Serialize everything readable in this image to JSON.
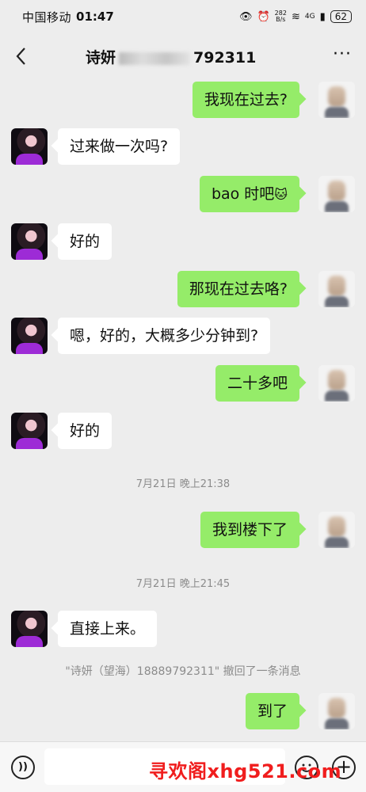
{
  "status": {
    "carrier": "中国移动",
    "time": "01:47",
    "net_speed_value": "282",
    "net_speed_unit": "B/s",
    "network": "4G",
    "battery": "62"
  },
  "header": {
    "title_start": "诗妍",
    "title_end": "792311",
    "back_icon": "chevron-left-icon",
    "more_icon": "more-dots-icon",
    "more_glyph": "···"
  },
  "messages": [
    {
      "from": "me",
      "text": "我现在过去?"
    },
    {
      "from": "them",
      "text": "过来做一次吗?"
    },
    {
      "from": "me",
      "text": "bao 时吧",
      "emoji": "🐱"
    },
    {
      "from": "them",
      "text": "好的"
    },
    {
      "from": "me",
      "text": "那现在过去咯?"
    },
    {
      "from": "them",
      "text": "嗯，好的，大概多少分钟到?"
    },
    {
      "from": "me",
      "text": "二十多吧"
    },
    {
      "from": "them",
      "text": "好的"
    },
    {
      "from": "me",
      "text": "我到楼下了"
    },
    {
      "from": "them",
      "text": "直接上来。"
    },
    {
      "from": "me",
      "text": "到了"
    }
  ],
  "timestamps": [
    "7月21日 晚上21:38",
    "7月21日 晚上21:45"
  ],
  "recall_notice": "\"诗妍（望海）18889792311\" 撤回了一条消息",
  "input_bar": {
    "voice_icon": "voice-icon",
    "emoji_icon": "emoji-icon",
    "plus_icon": "plus-icon",
    "plus_glyph": "+"
  },
  "watermark": "寻欢阁xhg521.com",
  "colors": {
    "background": "#ededed",
    "my_bubble": "#95ec69",
    "their_bubble": "#ffffff",
    "watermark": "#f01d1d"
  }
}
